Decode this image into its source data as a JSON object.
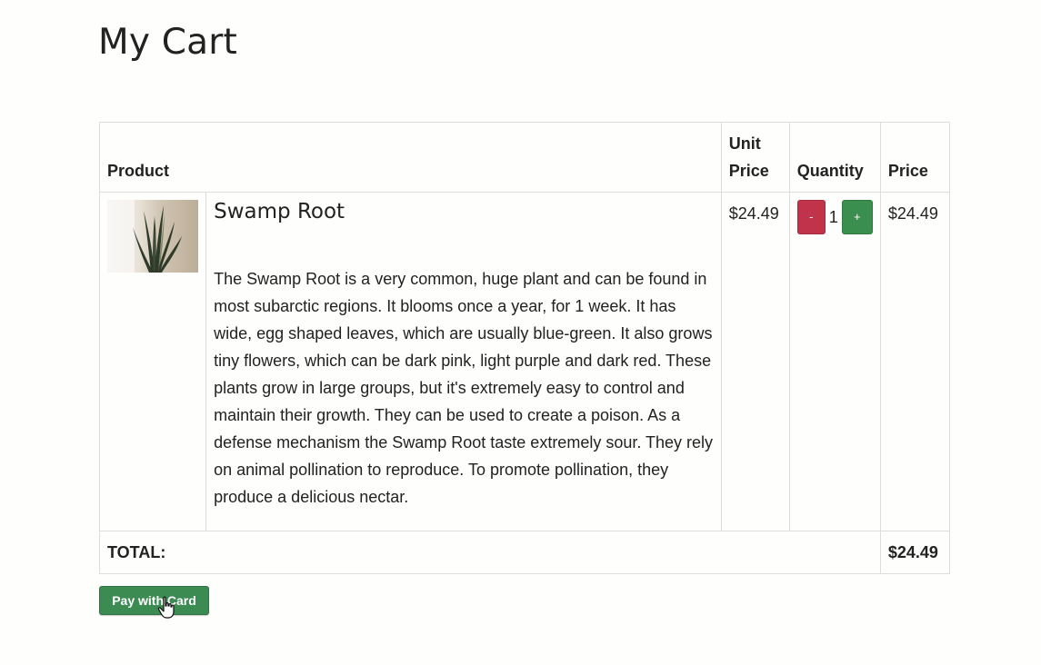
{
  "page": {
    "title": "My Cart"
  },
  "table": {
    "headers": {
      "product": "Product",
      "unit_price": "Unit Price",
      "quantity": "Quantity",
      "price": "Price"
    },
    "items": [
      {
        "name": "Swamp Root",
        "description": "The Swamp Root is a very common, huge plant and can be found in most subarctic regions. It blooms once a year, for 1 week. It has wide, egg shaped leaves, which are usually blue-green. It also grows tiny flowers, which can be dark pink, light purple and dark red. These plants grow in large groups, but it's extremely easy to control and maintain their growth. They can be used to create a poison. As a defense mechanism the Swamp Root taste extremely sour. They rely on animal pollination to reproduce. To promote pollination, they produce a delicious nectar.",
        "unit_price": "$24.49",
        "quantity": "1",
        "price": "$24.49",
        "decrement_label": "-",
        "increment_label": "+"
      }
    ],
    "total_label": "TOTAL:",
    "total_value": "$24.49"
  },
  "actions": {
    "pay_label": "Pay with Card"
  },
  "colors": {
    "decrement": "#c0334a",
    "increment": "#3a8e4e",
    "pay": "#3c8b53"
  },
  "icons": {
    "cursor": "hand-pointer-icon",
    "product_image": "snake-plant-image"
  }
}
